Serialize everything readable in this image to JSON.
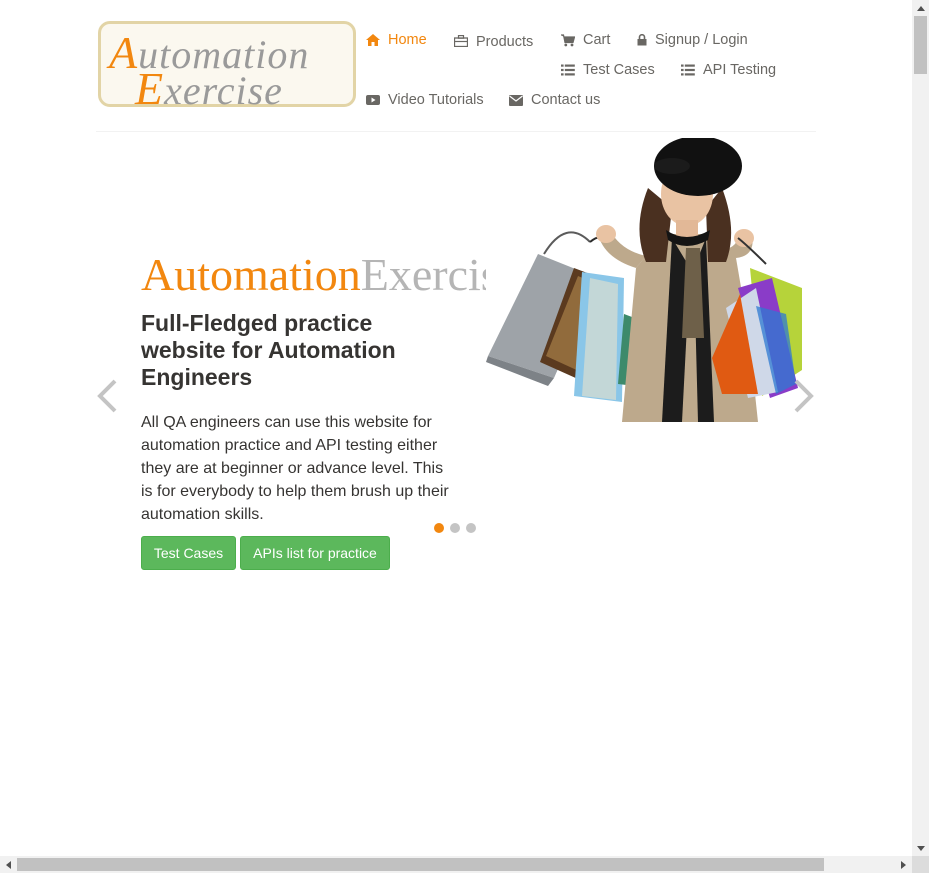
{
  "logo": {
    "line1_cap": "A",
    "line1_rest": "utomation",
    "line2_cap": "E",
    "line2_rest": "xercise"
  },
  "nav": {
    "home": "Home",
    "products": "Products",
    "cart": "Cart",
    "signup_login": "Signup / Login",
    "test_cases": "Test Cases",
    "api_testing": "API Testing",
    "video_tutorials": "Video Tutorials",
    "contact_us": "Contact us"
  },
  "hero": {
    "brand_part1": "Automation",
    "brand_part2": "Exercise",
    "heading": "Full-Fledged practice website for Automation Engineers",
    "text": "All QA engineers can use this website for automation practice and API testing either they are at beginner or advance level. This is for everybody to help them brush up their automation skills.",
    "btn_test_cases": "Test Cases",
    "btn_apis": "APIs list for practice"
  },
  "carousel": {
    "active_slide": 1,
    "total_slides": 3
  },
  "colors": {
    "accent": "#f2870f",
    "button": "#5cb85c",
    "text": "#363432",
    "nav_text": "#696763"
  },
  "icons": [
    "home-icon",
    "products-icon",
    "cart-icon",
    "lock-icon",
    "list-icon",
    "list-icon",
    "video-icon",
    "envelope-icon",
    "chevron-left-icon",
    "chevron-right-icon"
  ]
}
